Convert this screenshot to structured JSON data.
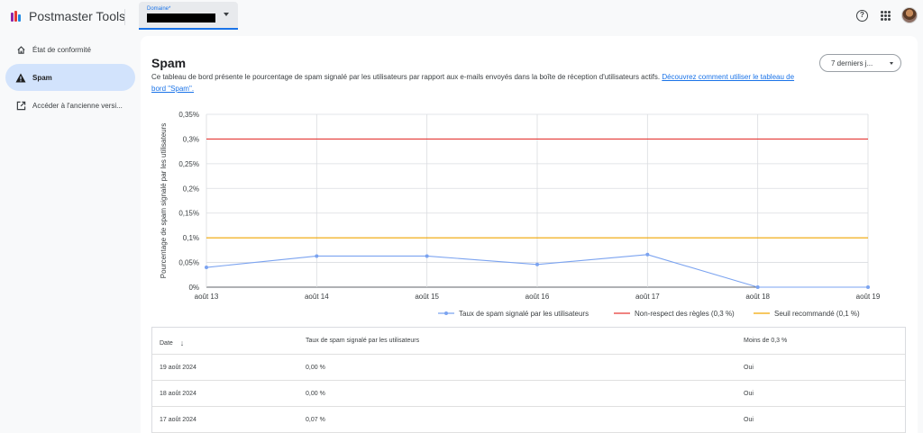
{
  "app": {
    "title": "Postmaster Tools"
  },
  "header": {
    "domain_label": "Domaine*",
    "help_icon": "help-icon",
    "apps_icon": "apps-grid-icon"
  },
  "sidebar": {
    "items": [
      {
        "label": "État de conformité",
        "icon": "home-icon"
      },
      {
        "label": "Spam",
        "icon": "warning-icon",
        "active": true
      },
      {
        "label": "Accéder à l'ancienne versi...",
        "icon": "open-in-new-icon"
      }
    ]
  },
  "main": {
    "title": "Spam",
    "description": "Ce tableau de bord présente le pourcentage de spam signalé par les utilisateurs par rapport aux e-mails envoyés dans la boîte de réception d'utilisateurs actifs.",
    "link_text": "Découvrez comment utiliser le tableau de bord \"Spam\".",
    "range": "7 derniers j..."
  },
  "chart_data": {
    "type": "line",
    "ylabel": "Pourcentage de spam signalé par les utilisateurs",
    "x": [
      "août 13",
      "août 14",
      "août 15",
      "août 16",
      "août 17",
      "août 18",
      "août 19"
    ],
    "y_ticks": [
      "0%",
      "0,05%",
      "0,1%",
      "0,15%",
      "0,2%",
      "0,25%",
      "0,3%",
      "0,35%"
    ],
    "ylim": [
      0,
      0.35
    ],
    "grid": true,
    "legend_position": "bottom-right",
    "series": [
      {
        "name": "Taux de spam signalé par les utilisateurs",
        "values": [
          0.04,
          0.063,
          0.063,
          0.046,
          0.066,
          0.0,
          0.0
        ],
        "color": "#7ba3f0",
        "markers": true
      },
      {
        "name": "Non-respect des règles (0,3 %)",
        "values": [
          0.3,
          0.3,
          0.3,
          0.3,
          0.3,
          0.3,
          0.3
        ],
        "color": "#e53935"
      },
      {
        "name": "Seuil recommandé (0,1 %)",
        "values": [
          0.1,
          0.1,
          0.1,
          0.1,
          0.1,
          0.1,
          0.1
        ],
        "color": "#f2a600"
      }
    ]
  },
  "table": {
    "headers": [
      "Date",
      "Taux de spam signalé par les utilisateurs",
      "Moins de 0,3 %"
    ],
    "sort_icon": "arrow-down-icon",
    "rows": [
      [
        "19 août 2024",
        "0,00 %",
        "Oui"
      ],
      [
        "18 août 2024",
        "0,00 %",
        "Oui"
      ],
      [
        "17 août 2024",
        "0,07 %",
        "Oui"
      ]
    ]
  }
}
